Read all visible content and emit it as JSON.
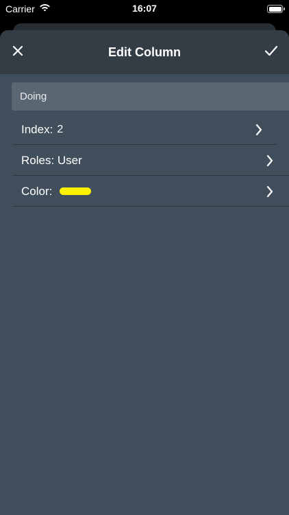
{
  "status_bar": {
    "carrier": "Carrier",
    "time": "16:07",
    "wifi_icon": "wifi-icon",
    "battery_icon": "battery-icon"
  },
  "nav": {
    "title": "Edit Column",
    "close_icon": "close-icon",
    "confirm_icon": "checkmark-icon"
  },
  "form": {
    "name_value": "Doing",
    "index": {
      "label": "Index:",
      "value": "2"
    },
    "roles": {
      "label": "Roles: User"
    },
    "color": {
      "label": "Color:",
      "value_color": "#fff200"
    }
  },
  "colors": {
    "sheet_background": "#414e5c",
    "nav_background": "#343d46",
    "field_background": "#5a6672",
    "accent_yellow": "#fff200"
  }
}
